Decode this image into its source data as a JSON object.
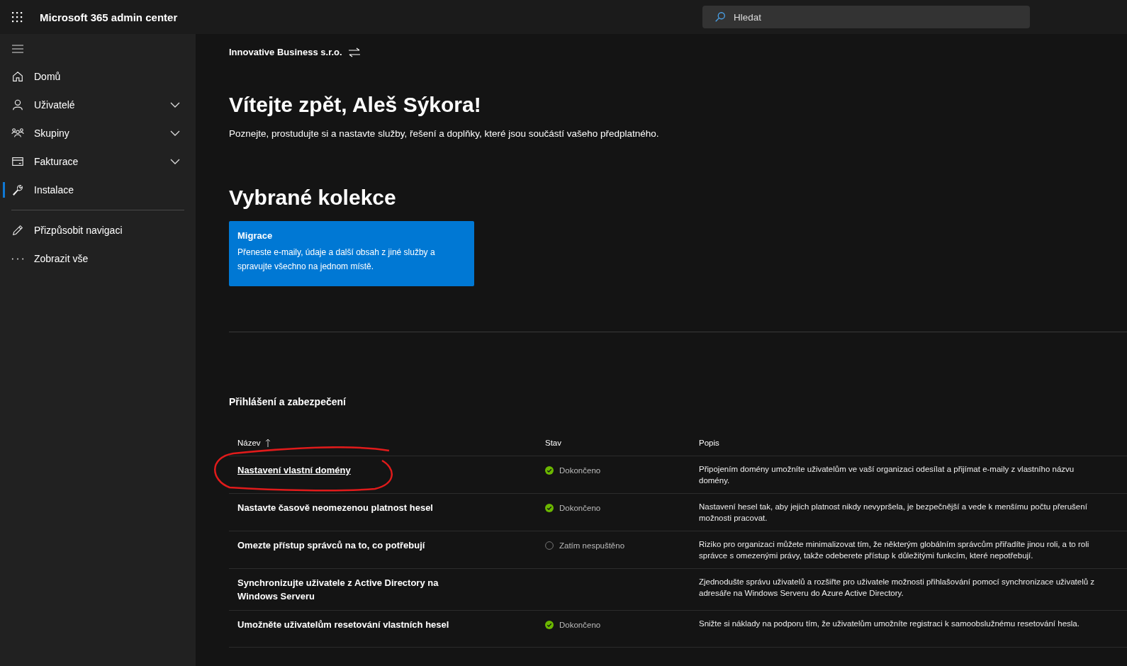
{
  "app_bar": {
    "title": "Microsoft 365 admin center",
    "search": {
      "placeholder": "Hledat"
    }
  },
  "sidebar": {
    "items": [
      {
        "label": "Domů",
        "expandable": false,
        "selected": false
      },
      {
        "label": "Uživatelé",
        "expandable": true,
        "selected": false
      },
      {
        "label": "Skupiny",
        "expandable": true,
        "selected": false
      },
      {
        "label": "Fakturace",
        "expandable": true,
        "selected": false
      },
      {
        "label": "Instalace",
        "expandable": false,
        "selected": true
      }
    ],
    "footer_items": [
      {
        "label": "Přizpůsobit navigaci"
      },
      {
        "label": "Zobrazit vše"
      }
    ]
  },
  "organization": "Innovative Business s.r.o.",
  "heading": "Vítejte zpět, Aleš Sýkora!",
  "intro": "Poznejte, prostudujte si a nastavte služby, řešení a doplňky, které jsou součástí vašeho předplatného.",
  "collections": {
    "title": "Vybrané kolekce",
    "cards": [
      {
        "title": "Migrace",
        "text": "Přeneste e-maily, údaje a další obsah z jiné služby a spravujte všechno na jednom místě."
      }
    ]
  },
  "section": {
    "title": "Přihlášení a zabezpečení",
    "columns": [
      {
        "label": "Název",
        "sorted": true
      },
      {
        "label": "Stav",
        "sorted": false
      },
      {
        "label": "Popis",
        "sorted": false
      }
    ],
    "rows": [
      {
        "name": "Nastavení vlastní domény",
        "underlined": true,
        "circled": true,
        "status": {
          "kind": "done",
          "label": "Dokončeno"
        },
        "description": "Připojením domény umožníte uživatelům ve vaší organizaci odesílat a přijímat e-maily z vlastního názvu domény."
      },
      {
        "name": "Nastavte časově neomezenou platnost hesel",
        "underlined": false,
        "circled": false,
        "status": {
          "kind": "done",
          "label": "Dokončeno"
        },
        "description": "Nastavení hesel tak, aby jejich platnost nikdy nevypršela, je bezpečnější a vede k menšímu počtu přerušení možnosti pracovat."
      },
      {
        "name": "Omezte přístup správců na to, co potřebují",
        "underlined": false,
        "circled": false,
        "status": {
          "kind": "not_started",
          "label": "Zatím nespuštěno"
        },
        "description": "Riziko pro organizaci můžete minimalizovat tím, že některým globálním správcům přiřadíte jinou roli, a to roli správce s omezenými právy, takže odeberete přístup k důležitými funkcím, které nepotřebují."
      },
      {
        "name": "Synchronizujte uživatele z Active Directory na Windows Serveru",
        "underlined": false,
        "circled": false,
        "description": "Zjednodušte správu uživatelů a rozšiřte pro uživatele možnosti přihlašování pomocí synchronizace uživatelů z adresáře na Windows Serveru do Azure Active Directory."
      },
      {
        "name": "Umožněte uživatelům resetování vlastních hesel",
        "underlined": false,
        "circled": false,
        "status": {
          "kind": "done",
          "label": "Dokončeno"
        },
        "description": "Snižte si náklady na podporu tím, že uživatelům umožníte registraci k samoobslužnému resetování hesla."
      }
    ]
  }
}
